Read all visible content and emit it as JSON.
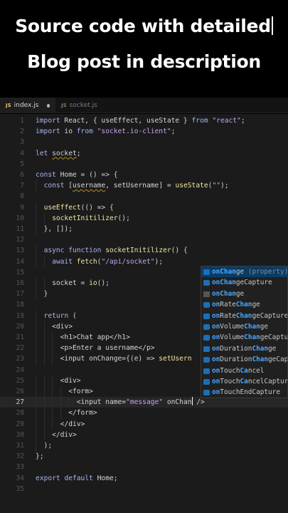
{
  "caption": {
    "line1": "Source code with detailed",
    "line2": "Blog post in description"
  },
  "tabs": [
    {
      "icon": "JS",
      "label": "index.js",
      "modified": true
    },
    {
      "icon": "JS",
      "label": "socket.js",
      "modified": false
    }
  ],
  "editor": {
    "current_line": 27,
    "lines": [
      {
        "n": "1",
        "c": "import React, { useEffect, useState } from \"react\";"
      },
      {
        "n": "2",
        "c": "import io from \"socket.io-client\";"
      },
      {
        "n": "3",
        "c": ""
      },
      {
        "n": "4",
        "c": "let socket;"
      },
      {
        "n": "5",
        "c": ""
      },
      {
        "n": "6",
        "c": "const Home = () => {"
      },
      {
        "n": "7",
        "c": "  const [username, setUsername] = useState(\"\");"
      },
      {
        "n": "8",
        "c": ""
      },
      {
        "n": "9",
        "c": "  useEffect(() => {"
      },
      {
        "n": "10",
        "c": "    socketInitilizer();"
      },
      {
        "n": "11",
        "c": "  }, []);"
      },
      {
        "n": "12",
        "c": ""
      },
      {
        "n": "13",
        "c": "  async function socketInitilizer() {"
      },
      {
        "n": "14",
        "c": "    await fetch(\"/api/socket\");"
      },
      {
        "n": "15",
        "c": ""
      },
      {
        "n": "16",
        "c": "    socket = io();"
      },
      {
        "n": "17",
        "c": "  }"
      },
      {
        "n": "18",
        "c": ""
      },
      {
        "n": "19",
        "c": "  return ("
      },
      {
        "n": "20",
        "c": "    <div>"
      },
      {
        "n": "21",
        "c": "      <h1>Chat app</h1>"
      },
      {
        "n": "22",
        "c": "      <p>Enter a username</p>"
      },
      {
        "n": "23",
        "c": "      <input onChange={(e) => setUsern"
      },
      {
        "n": "24",
        "c": ""
      },
      {
        "n": "25",
        "c": "      <div>"
      },
      {
        "n": "26",
        "c": "        <form>"
      },
      {
        "n": "27",
        "c": "          <input name=\"message\" onChan"
      },
      {
        "n": "28",
        "c": "        </form>"
      },
      {
        "n": "29",
        "c": "      </div>"
      },
      {
        "n": "30",
        "c": "    </div>"
      },
      {
        "n": "31",
        "c": "  );"
      },
      {
        "n": "32",
        "c": "};"
      },
      {
        "n": "33",
        "c": ""
      },
      {
        "n": "34",
        "c": "export default Home;"
      },
      {
        "n": "35",
        "c": ""
      }
    ],
    "line27_tail": " />"
  },
  "suggestions": [
    {
      "label": "onChange",
      "detail": " (property)",
      "icon": "property-icon",
      "selected": true
    },
    {
      "label": "onChangeCapture",
      "detail": "",
      "icon": "property-icon",
      "selected": false
    },
    {
      "label": "onChange",
      "detail": "",
      "icon": "keyword-icon",
      "selected": false
    },
    {
      "label": "onRateChange",
      "detail": "",
      "icon": "property-icon",
      "selected": false
    },
    {
      "label": "onRateChangeCapture",
      "detail": "",
      "icon": "property-icon",
      "selected": false
    },
    {
      "label": "onVolumeChange",
      "detail": "",
      "icon": "property-icon",
      "selected": false
    },
    {
      "label": "onVolumeChangeCapture",
      "detail": "",
      "icon": "property-icon",
      "selected": false
    },
    {
      "label": "onDurationChange",
      "detail": "",
      "icon": "property-icon",
      "selected": false
    },
    {
      "label": "onDurationChangeCapture",
      "detail": "",
      "icon": "property-icon",
      "selected": false
    },
    {
      "label": "onTouchCancel",
      "detail": "",
      "icon": "property-icon",
      "selected": false
    },
    {
      "label": "onTouchCancelCapture",
      "detail": "",
      "icon": "property-icon",
      "selected": false
    },
    {
      "label": "onTouchEndCapture",
      "detail": "",
      "icon": "property-icon",
      "selected": false
    }
  ],
  "colors": {
    "keyword": "#a8b4f2",
    "string": "#c3a2f0",
    "function": "#f3e6a0",
    "match": "#4aa8ff",
    "selection": "#0b3b66"
  }
}
